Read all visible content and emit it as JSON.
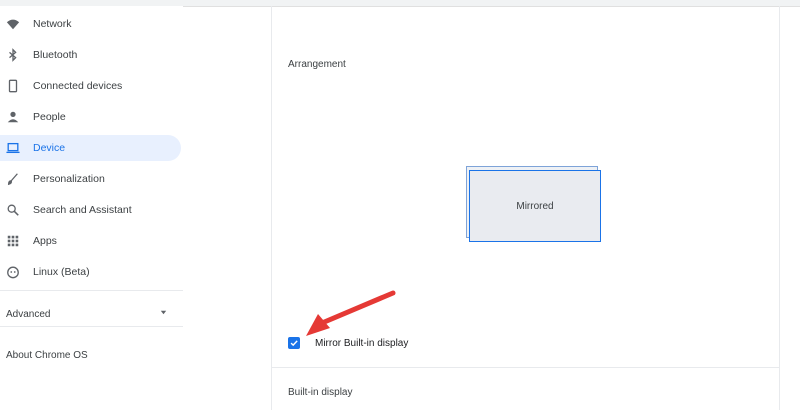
{
  "sidebar": {
    "items": [
      {
        "label": "Network",
        "icon": "wifi-icon"
      },
      {
        "label": "Bluetooth",
        "icon": "bluetooth-icon"
      },
      {
        "label": "Connected devices",
        "icon": "phone-icon"
      },
      {
        "label": "People",
        "icon": "person-icon"
      },
      {
        "label": "Device",
        "icon": "laptop-icon",
        "active": true
      },
      {
        "label": "Personalization",
        "icon": "brush-icon"
      },
      {
        "label": "Search and Assistant",
        "icon": "search-icon"
      },
      {
        "label": "Apps",
        "icon": "apps-grid-icon"
      },
      {
        "label": "Linux (Beta)",
        "icon": "linux-icon"
      }
    ],
    "advanced": "Advanced",
    "about": "About Chrome OS"
  },
  "main": {
    "arrangement_title": "Arrangement",
    "display_label": "Mirrored",
    "mirror_checkbox": {
      "label": "Mirror Built-in display",
      "checked": true
    },
    "builtin_title": "Built-in display"
  },
  "colors": {
    "accent": "#1a73e8",
    "active_bg": "#e8f0fe",
    "arrow": "#e53935"
  }
}
